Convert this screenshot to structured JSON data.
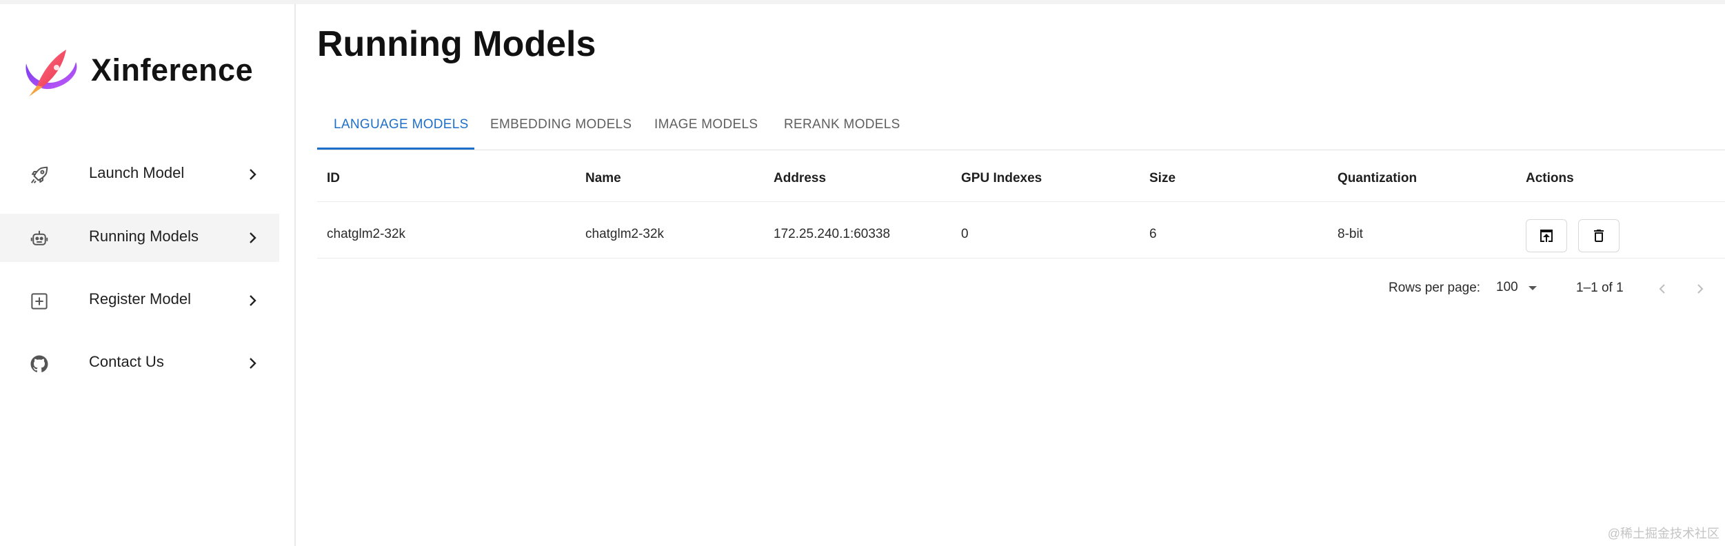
{
  "app": {
    "brand": "Xinference"
  },
  "sidebar": {
    "items": [
      {
        "label": "Launch Model",
        "icon": "rocket-icon"
      },
      {
        "label": "Running Models",
        "icon": "robot-icon",
        "active": true
      },
      {
        "label": "Register Model",
        "icon": "plus-square-icon"
      },
      {
        "label": "Contact Us",
        "icon": "github-icon"
      }
    ]
  },
  "page": {
    "title": "Running Models"
  },
  "tabs": [
    {
      "label": "LANGUAGE MODELS",
      "active": true
    },
    {
      "label": "EMBEDDING MODELS"
    },
    {
      "label": "IMAGE MODELS"
    },
    {
      "label": "RERANK MODELS"
    }
  ],
  "table": {
    "columns": [
      "ID",
      "Name",
      "Address",
      "GPU Indexes",
      "Size",
      "Quantization",
      "Actions"
    ],
    "rows": [
      {
        "id": "chatglm2-32k",
        "name": "chatglm2-32k",
        "address": "172.25.240.1:60338",
        "gpu_indexes": "0",
        "size": "6",
        "quantization": "8-bit"
      }
    ],
    "actions": [
      "open-in-new-icon",
      "delete-icon"
    ]
  },
  "pagination": {
    "rows_per_page_label": "Rows per page:",
    "rows_per_page": "100",
    "range": "1–1 of 1"
  },
  "watermark": "@稀土掘金技术社区",
  "colors": {
    "accent": "#1e6fc9",
    "active_bg": "#f4f4f4"
  }
}
